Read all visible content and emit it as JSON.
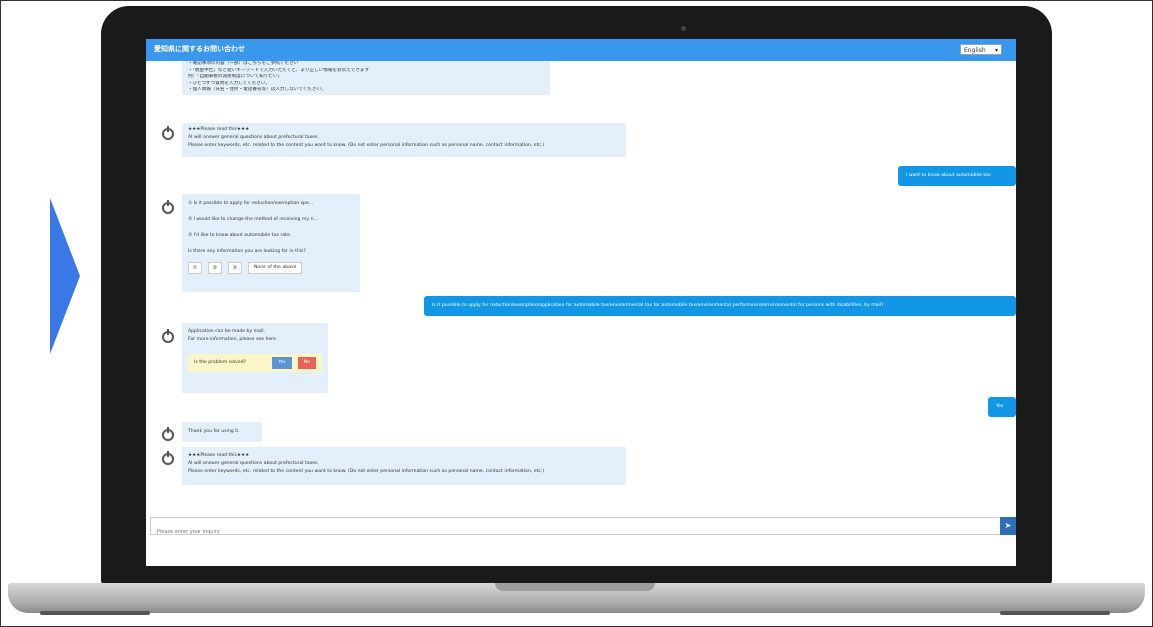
{
  "header": {
    "title": "愛知県に関するお問い合わせ",
    "language": "English"
  },
  "messages": {
    "intro_lines": [
      "・確認事項の内容（一部）はこちらをご参照ください",
      "・「税金申告」など短いキーワードで入力いただくと、より正しい情報をお伝えできます",
      "例：「自動車税の減免制度について知りたい」",
      "・ひとつずつ質問を入力してください。",
      "・個人情報（氏名・住所・電話番号等）は入力しないでください。"
    ],
    "notice1_title": "★★★Please read this★★★",
    "notice1_line1": "AI will answer general questions about prefectural taxes.",
    "notice1_line2": "Please enter keywords, etc. related to the content you want to know. (Do not enter personal information such as personal name, contact information, etc.)",
    "user1": "I want to know about automobile tax",
    "options": [
      "① Is it possible to apply for reduction/exemption spe...",
      "② I would like to change the method of receiving my n...",
      "③ I'd like to know about automobile tax rate."
    ],
    "options_prompt": "Is there any information you are looking for in this?",
    "none_label": "None of the above",
    "user2": "Is it possible to apply for reduction/exemption/application for automobile tax/environmental tax for automobile tax/environmental performance/environmental for persons with disabilities, by mail?",
    "answer_line1": "Application can be made by mail.",
    "answer_line2": "For more information, please see here.",
    "survey_question": "Is the problem solved?",
    "yes_label": "Yes",
    "no_label": "No",
    "user3": "Yes",
    "thanks": "Thank you for using it.",
    "notice2_title": "★★★Please read this★★★",
    "notice2_line1": "AI will answer general questions about prefectural taxes.",
    "notice2_line2": "Please enter keywords, etc. related to the content you want to know. (Do not enter personal information such as personal name, contact information, etc.)"
  },
  "input": {
    "placeholder": "Please enter your inquiry"
  },
  "colors": {
    "header": "#3a97ee",
    "user_bubble": "#1296e6",
    "bot_bubble": "#e3f0fb",
    "arrow": "#3b78e7"
  }
}
